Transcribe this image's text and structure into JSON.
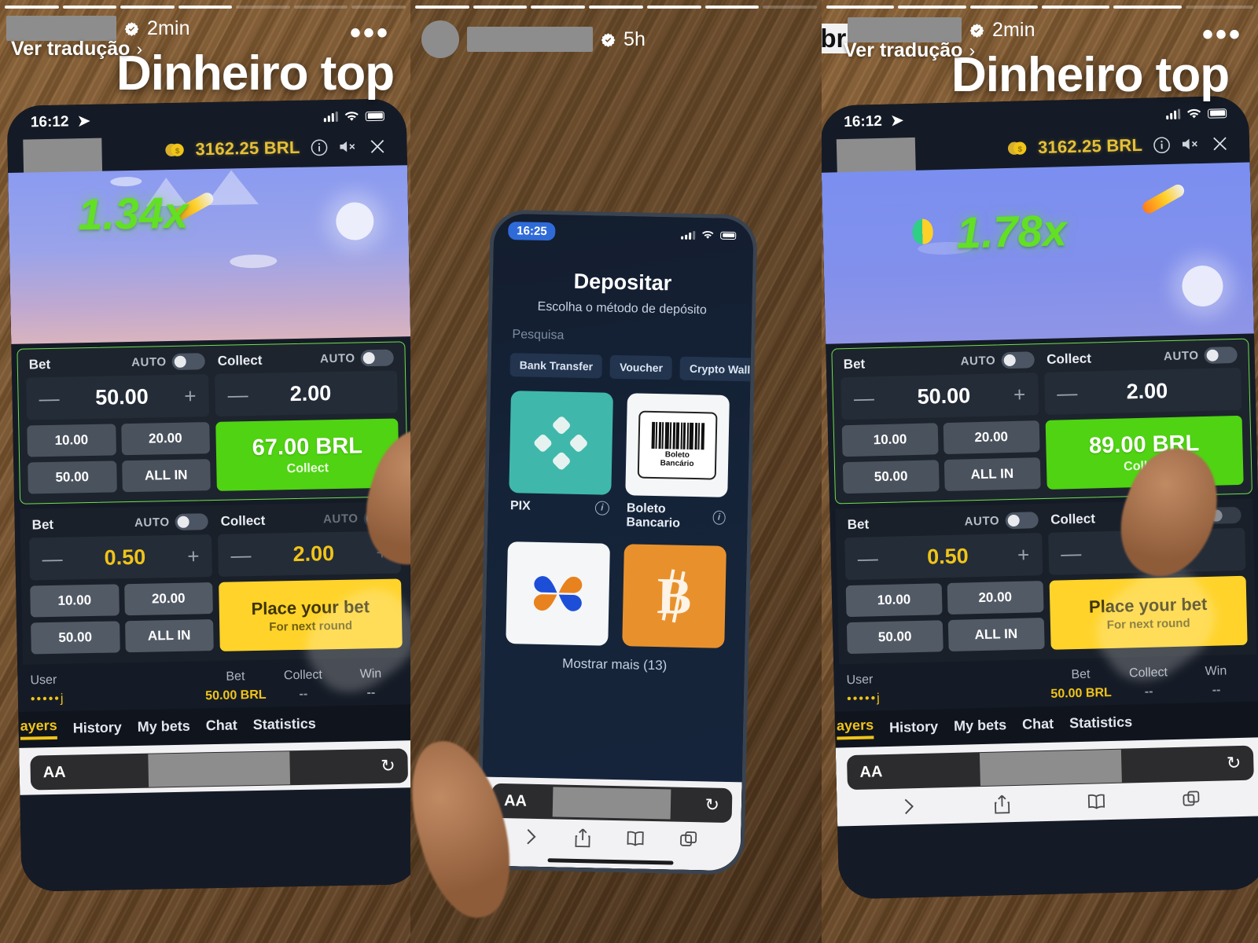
{
  "story": {
    "segments_total": 7,
    "translate_label": "Ver tradução",
    "chevron": "›",
    "more_dots": "•••",
    "verified_icon": "verified-badge-icon",
    "panels": [
      {
        "ago": "2min",
        "caption": "Dinheiro top",
        "hashtag": ""
      },
      {
        "ago": "5h",
        "caption": "",
        "hashtag": ""
      },
      {
        "ago": "2min",
        "caption": "Dinheiro top",
        "hashtag": "#br"
      }
    ]
  },
  "phone_game": {
    "status": {
      "time": "16:12",
      "location_icon": "location-arrow-icon",
      "signal_icon": "cellular-bars-icon",
      "wifi_icon": "wifi-icon",
      "battery_icon": "battery-icon"
    },
    "header": {
      "coin_icon": "coin-icon",
      "balance": "3162.25 BRL",
      "info_icon": "info-circle-icon",
      "mute_icon": "speaker-mute-icon",
      "close_icon": "close-x-icon"
    },
    "game": {
      "multiplier_p1": "1.34x",
      "multiplier_p3": "1.78x",
      "plane_icon": "rocket-plane-icon",
      "balloon_icon": "hot-air-balloon-icon",
      "sun_icon": "sun-icon"
    },
    "bet_panel_top": {
      "bet_label": "Bet",
      "collect_label": "Collect",
      "auto_label": "AUTO",
      "minus": "—",
      "plus": "+",
      "bet_value": "50.00",
      "collect_value": "2.00",
      "quick_amounts": [
        "10.00",
        "20.00",
        "50.00",
        "ALL IN"
      ],
      "cta_p1_amount": "67.00 BRL",
      "cta_p3_amount": "89.00 BRL",
      "cta_sub": "Collect"
    },
    "bet_panel_bottom": {
      "bet_label": "Bet",
      "collect_label": "Collect",
      "auto_label": "AUTO",
      "minus": "—",
      "plus": "+",
      "bet_value": "0.50",
      "collect_value": "2.00",
      "quick_amounts": [
        "10.00",
        "20.00",
        "50.00",
        "ALL IN"
      ],
      "cta_title": "Place your bet",
      "cta_sub": "For next round"
    },
    "bet_list": {
      "columns": [
        "User",
        "Bet",
        "Collect",
        "Win"
      ],
      "row": {
        "user": "•••••j",
        "bet": "50.00 BRL",
        "collect": "--",
        "win": "--"
      }
    },
    "tabs": [
      {
        "label": "ayers",
        "active": true
      },
      {
        "label": "History",
        "active": false
      },
      {
        "label": "My bets",
        "active": false
      },
      {
        "label": "Chat",
        "active": false
      },
      {
        "label": "Statistics",
        "active": false
      }
    ],
    "safari": {
      "text_size_label": "AA",
      "reload_icon": "reload-icon",
      "forward_icon": "forward-chevron-icon",
      "share_icon": "share-icon",
      "bookmarks_icon": "book-icon",
      "tabs_icon": "tabs-icon"
    }
  },
  "phone_deposit": {
    "status": {
      "time": "16:25",
      "signal_icon": "cellular-bars-icon",
      "wifi_icon": "wifi-icon",
      "battery_icon": "battery-icon"
    },
    "title": "Depositar",
    "subtitle": "Escolha o método de depósito",
    "search_placeholder": "Pesquisa",
    "chips": [
      "Bank Transfer",
      "Voucher",
      "Crypto Wallet"
    ],
    "methods": [
      {
        "label": "PIX",
        "icon": "pix-logo-icon",
        "style": "teal",
        "info_icon": "info-circle-icon"
      },
      {
        "label": "Boleto Bancario",
        "icon": "boleto-barcode-icon",
        "style": "white",
        "info_icon": "info-circle-icon",
        "barcode_text_line1": "Boleto",
        "barcode_text_line2": "Bancário"
      },
      {
        "label": "",
        "icon": "clover-logo-icon",
        "style": "white",
        "info_icon": ""
      },
      {
        "label": "",
        "icon": "bitcoin-icon",
        "style": "orange",
        "info_icon": ""
      }
    ],
    "show_more": "Mostrar mais (13)",
    "safari": {
      "text_size_label": "AA",
      "reload_icon": "reload-icon",
      "forward_icon": "forward-chevron-icon",
      "share_icon": "share-icon",
      "bookmarks_icon": "book-icon",
      "tabs_icon": "tabs-icon"
    }
  },
  "colors": {
    "accent_green": "#4fd312",
    "accent_yellow": "#ffd32a",
    "balance_gold": "#e5c038",
    "multiplier_green": "#62e024",
    "wood_brown": "#7d5730"
  }
}
